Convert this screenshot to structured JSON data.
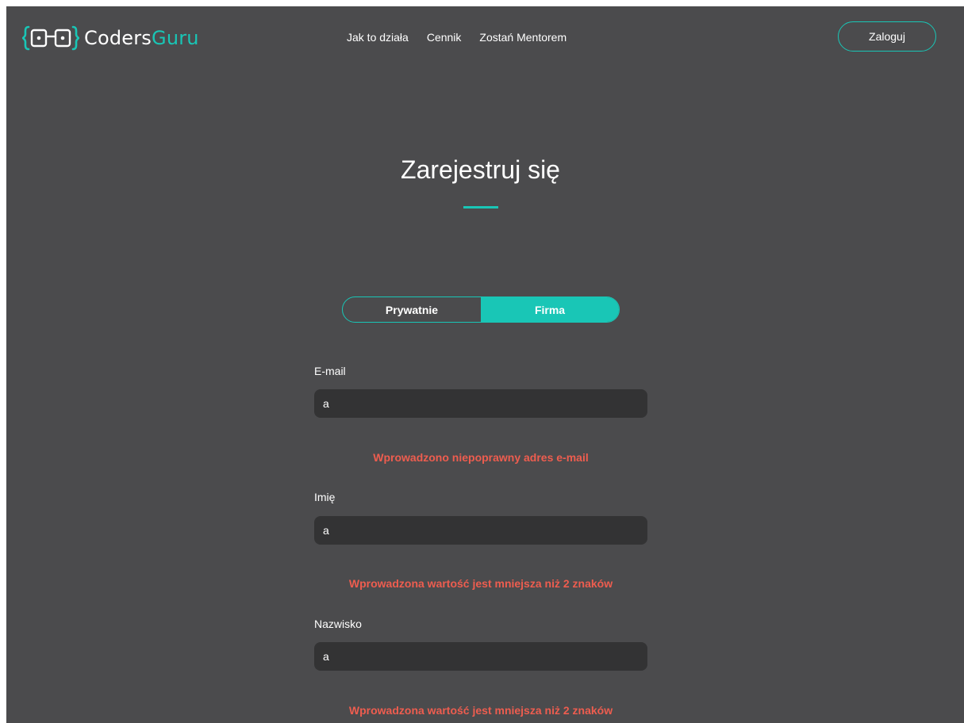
{
  "header": {
    "logo_text_1": "Coders",
    "logo_text_2": "Guru",
    "nav": [
      "Jak to działa",
      "Cennik",
      "Zostań Mentorem"
    ],
    "login_label": "Zaloguj"
  },
  "main": {
    "title": "Zarejestruj się",
    "account_type": {
      "options": [
        "Prywatnie",
        "Firma"
      ],
      "selected": "Firma"
    },
    "fields": [
      {
        "label": "E-mail",
        "value": "a",
        "error": "Wprowadzono niepoprawny adres e-mail"
      },
      {
        "label": "Imię",
        "value": "a",
        "error": "Wprowadzona wartość jest mniejsza niż 2 znaków"
      },
      {
        "label": "Nazwisko",
        "value": "a",
        "error": "Wprowadzona wartość jest mniejsza niż 2 znaków"
      }
    ]
  },
  "colors": {
    "background": "#4b4b4d",
    "accent": "#19c6b6",
    "input_bg": "#333334",
    "error": "#ee5d4f"
  },
  "icons": {
    "logo": "brackets-eyes-logo-icon"
  }
}
